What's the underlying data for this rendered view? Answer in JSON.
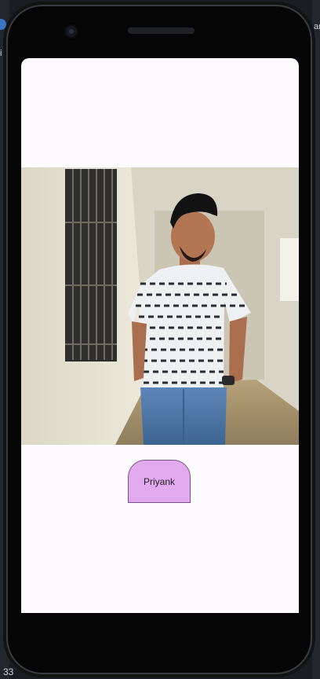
{
  "app": {
    "profile_name": "Priyank",
    "photo_alt": "Portrait photo of a man in a striped t-shirt standing in a hallway"
  },
  "ide_fragments": {
    "right_top": "ar",
    "right_mid": "i",
    "left_mid": "i",
    "bottom_left": "33"
  },
  "colors": {
    "screen_bg": "#fefbff",
    "chip_bg": "#e2a9ef",
    "chip_border": "#7a4f87",
    "device_frame": "#050505"
  },
  "icons": [
    "front-camera-icon",
    "speaker-grille"
  ]
}
